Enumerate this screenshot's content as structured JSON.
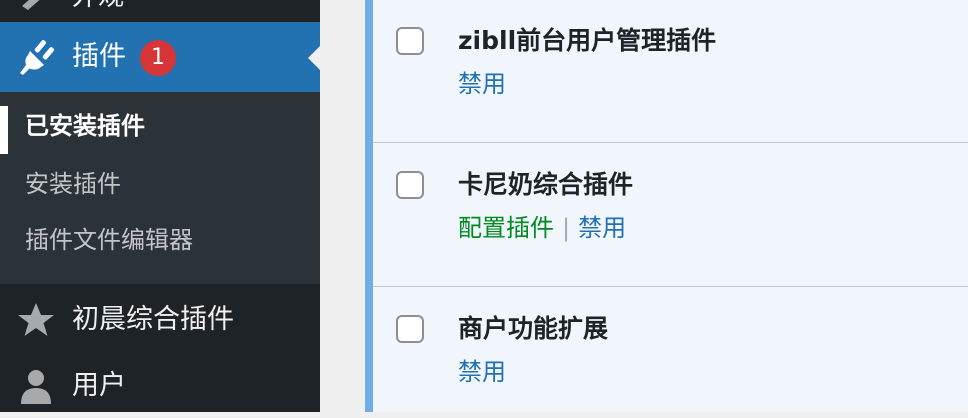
{
  "sidebar": {
    "partial_item": {
      "label": "外观",
      "icon": "paintbrush-icon"
    },
    "active_menu": {
      "label": "插件",
      "icon": "plugin-plug-icon",
      "badge": "1"
    },
    "submenu": [
      {
        "label": "已安装插件",
        "current": true
      },
      {
        "label": "安装插件",
        "current": false
      },
      {
        "label": "插件文件编辑器",
        "current": false
      }
    ],
    "menu_items": [
      {
        "label": "初晨综合插件",
        "icon": "star-icon"
      },
      {
        "label": "用户",
        "icon": "user-icon"
      }
    ]
  },
  "plugins": [
    {
      "name": "zibll前台用户管理插件",
      "actions": [
        "禁用"
      ]
    },
    {
      "name": "卡尼奶综合插件",
      "config_action": "配置插件",
      "separator": "|",
      "actions": [
        "禁用"
      ]
    },
    {
      "name": "商户功能扩展",
      "actions": [
        "禁用"
      ]
    }
  ],
  "colors": {
    "sidebar_bg": "#1d2327",
    "submenu_bg": "#2c3338",
    "active_menu_bg": "#2271b1",
    "badge_bg": "#d63638",
    "link": "#2271b1",
    "config_link": "#008a20",
    "active_plugin_bar": "#72aee6",
    "active_plugin_bg": "#f0f6fc"
  }
}
